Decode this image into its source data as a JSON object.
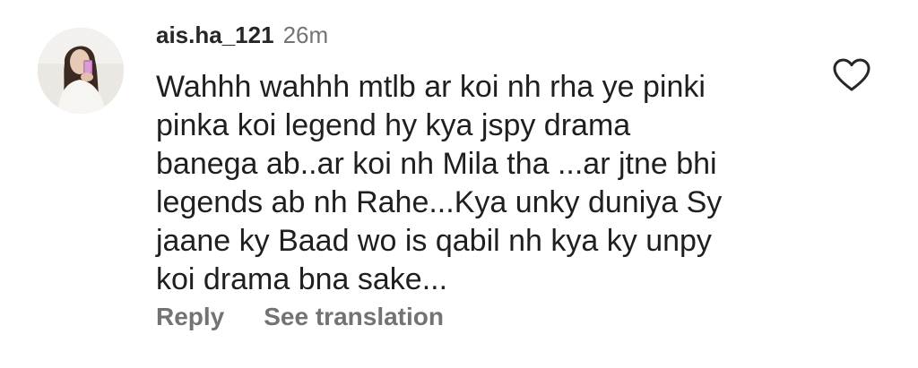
{
  "comment": {
    "username": "ais.ha_121",
    "timestamp": "26m",
    "text_lines": [
      "Wahhh wahhh mtlb ar koi nh rha ye pinki",
      "pinka koi legend hy kya jspy drama",
      "banega ab..ar koi nh Mila tha ...ar jtne bhi",
      "legends ab nh Rahe...Kya unky duniya Sy",
      "jaane ky Baad wo is qabil nh kya ky unpy",
      "koi drama bna sake..."
    ],
    "avatar_icon": "profile-photo",
    "like_icon": "heart-outline-icon"
  },
  "actions": {
    "reply_label": "Reply",
    "translate_label": "See translation"
  },
  "colors": {
    "username": "#262626",
    "secondary": "#737373",
    "body_text": "#1f1f1f"
  }
}
